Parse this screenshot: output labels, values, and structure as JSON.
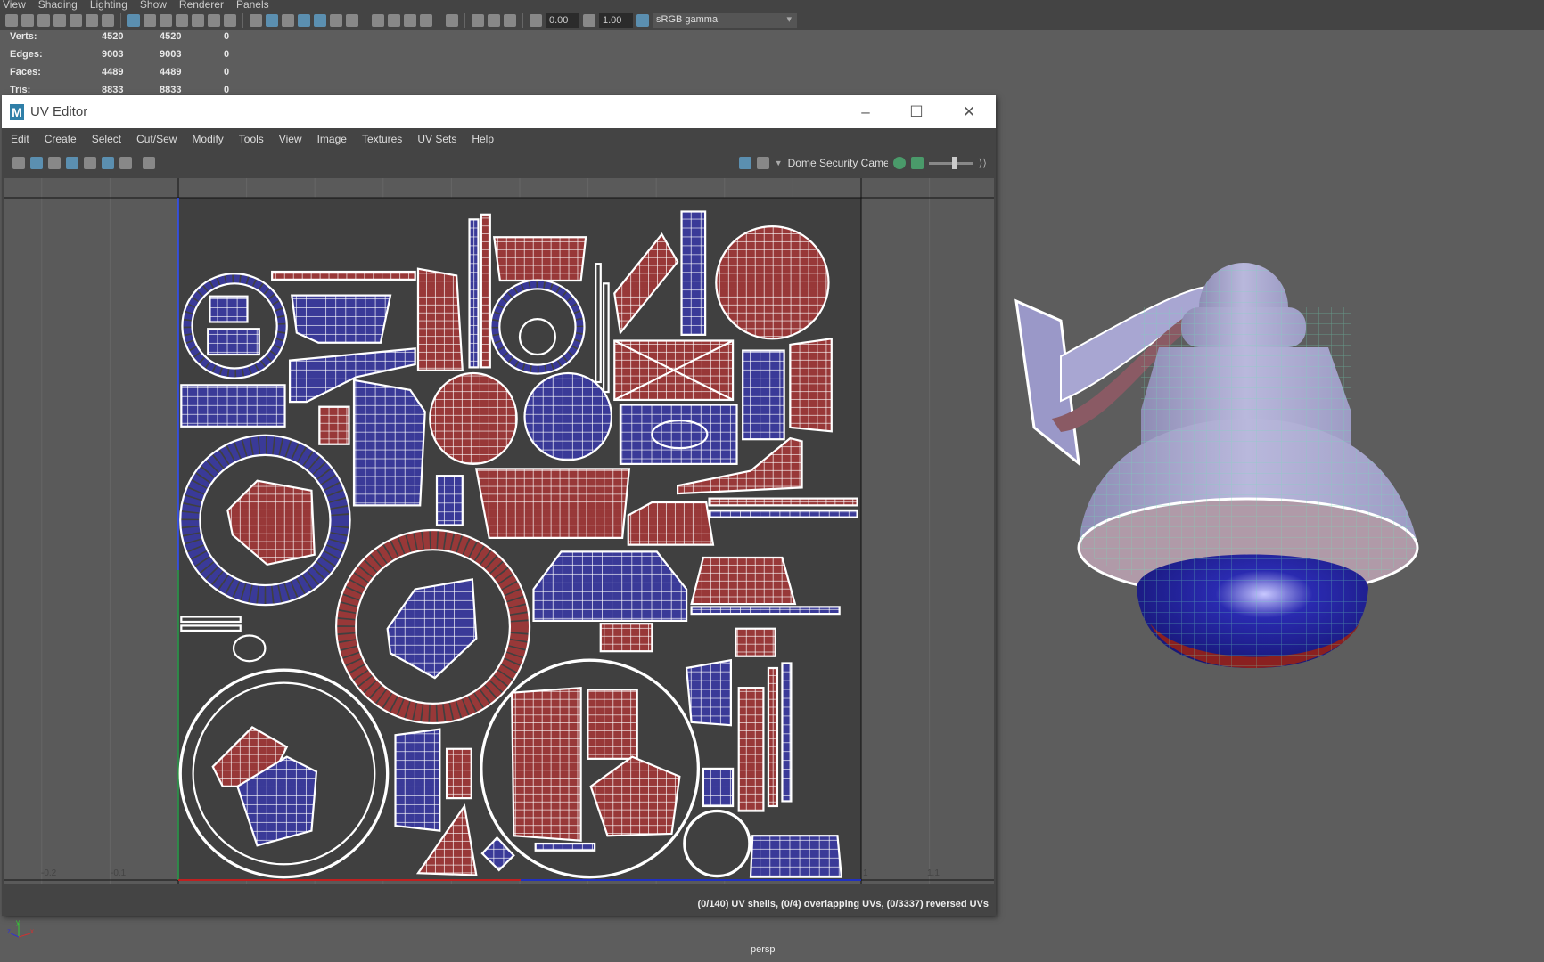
{
  "main_menu": [
    "View",
    "Shading",
    "Lighting",
    "Show",
    "Renderer",
    "Panels"
  ],
  "toolbar": {
    "exposure": "0.00",
    "gamma": "1.00",
    "color_space": "sRGB gamma"
  },
  "hud": {
    "rows": [
      {
        "label": "Verts:",
        "a": "4520",
        "b": "4520",
        "c": "0"
      },
      {
        "label": "Edges:",
        "a": "9003",
        "b": "9003",
        "c": "0"
      },
      {
        "label": "Faces:",
        "a": "4489",
        "b": "4489",
        "c": "0"
      },
      {
        "label": "Tris:",
        "a": "8833",
        "b": "8833",
        "c": "0"
      }
    ]
  },
  "uv_editor": {
    "title": "UV Editor",
    "logo": "M",
    "menu": [
      "Edit",
      "Create",
      "Select",
      "Cut/Sew",
      "Modify",
      "Tools",
      "View",
      "Image",
      "Textures",
      "UV Sets",
      "Help"
    ],
    "texture_name": "Dome Security Camera",
    "ruler": [
      "-0.2",
      "-0.1",
      "1",
      "1.1"
    ],
    "status": "(0/140) UV shells, (0/4) overlapping UVs, (0/3337) reversed UVs",
    "colors": {
      "red_shell": "#983838",
      "blue_shell": "#3a3a98",
      "canvas": "#404040"
    }
  },
  "viewport": {
    "camera": "persp",
    "axes": [
      "x",
      "y",
      "z"
    ]
  }
}
